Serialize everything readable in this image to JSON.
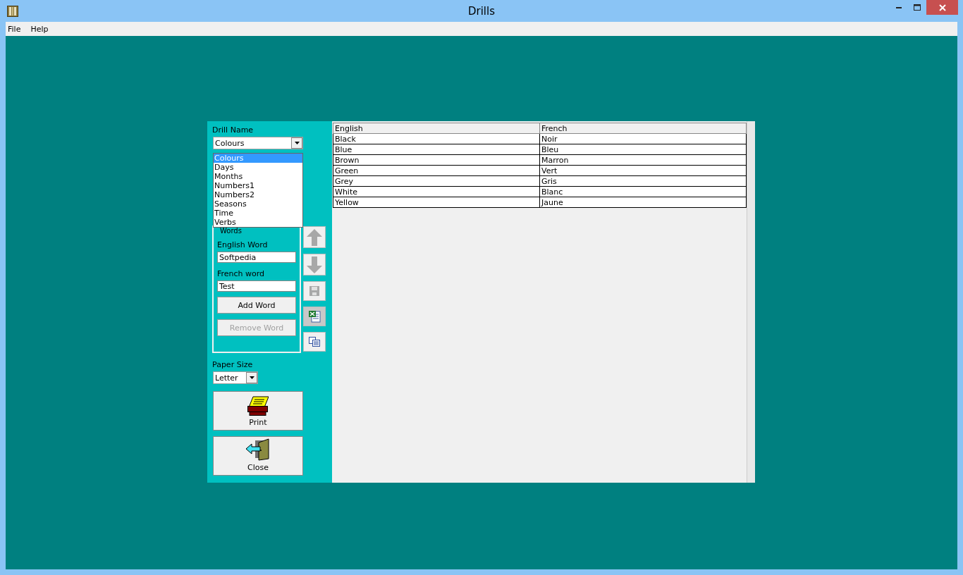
{
  "window": {
    "title": "Drills"
  },
  "menu": [
    {
      "label": "File"
    },
    {
      "label": "Help"
    }
  ],
  "drill_name": {
    "label": "Drill Name",
    "value": "Colours",
    "options": [
      {
        "label": "Colours",
        "selected": true
      },
      {
        "label": "Days",
        "selected": false
      },
      {
        "label": "Months",
        "selected": false
      },
      {
        "label": "Numbers1",
        "selected": false
      },
      {
        "label": "Numbers2",
        "selected": false
      },
      {
        "label": "Seasons",
        "selected": false
      },
      {
        "label": "Time",
        "selected": false
      },
      {
        "label": "Verbs",
        "selected": false
      }
    ]
  },
  "words_group": {
    "title": "Words",
    "english_label": "English Word",
    "english_value": "Softpedia",
    "french_label": "French word",
    "french_value": "Test",
    "buttons": [
      {
        "label": "Add Word",
        "disabled": false
      },
      {
        "label": "Remove Word",
        "disabled": true
      }
    ]
  },
  "tools": [
    {
      "kind": "up"
    },
    {
      "kind": "down"
    },
    {
      "kind": "save"
    },
    {
      "kind": "excel"
    },
    {
      "kind": "copy"
    }
  ],
  "paper_size": {
    "label": "Paper Size",
    "value": "Letter"
  },
  "actions": [
    {
      "kind": "print",
      "label": "Print"
    },
    {
      "kind": "close",
      "label": "Close"
    }
  ],
  "table": {
    "columns": [
      "English",
      "French"
    ],
    "rows": [
      [
        "Black",
        "Noir"
      ],
      [
        "Blue",
        "Bleu"
      ],
      [
        "Brown",
        "Marron"
      ],
      [
        "Green",
        "Vert"
      ],
      [
        "Grey",
        "Gris"
      ],
      [
        "White",
        "Blanc"
      ],
      [
        "Yellow",
        "Jaune"
      ]
    ]
  }
}
